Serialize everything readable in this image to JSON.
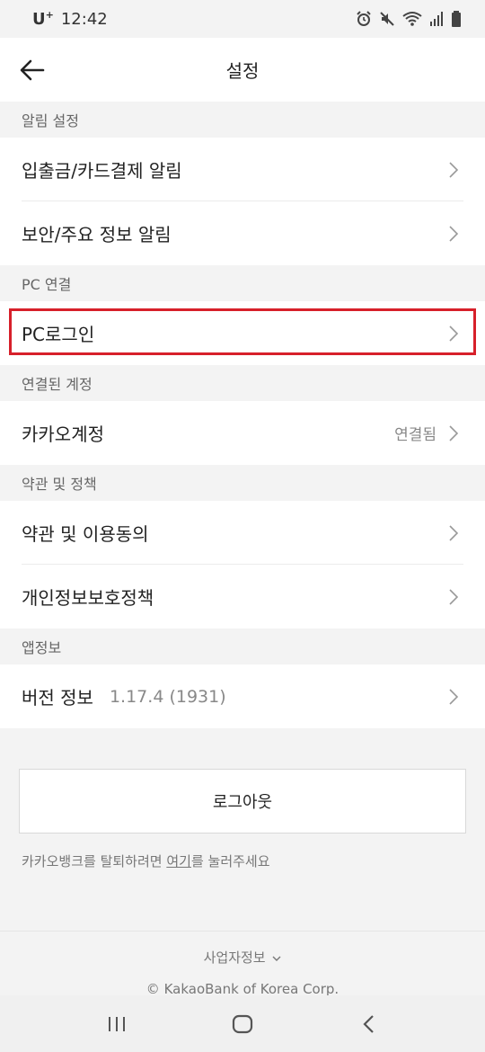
{
  "status_bar": {
    "carrier": "U",
    "carrier_sup": "+",
    "time": "12:42"
  },
  "header": {
    "title": "설정"
  },
  "sections": {
    "notifications": {
      "title": "알림 설정",
      "items": [
        "입출금/카드결제 알림",
        "보안/주요 정보 알림"
      ]
    },
    "pc": {
      "title": "PC 연결",
      "items": [
        "PC로그인"
      ]
    },
    "linked": {
      "title": "연결된 계정",
      "items": [
        {
          "label": "카카오계정",
          "value": "연결됨"
        }
      ]
    },
    "policy": {
      "title": "약관 및 정책",
      "items": [
        "약관 및 이용동의",
        "개인정보보호정책"
      ]
    },
    "appinfo": {
      "title": "앱정보",
      "items": [
        {
          "label": "버전 정보",
          "value": "1.17.4 (1931)"
        }
      ]
    }
  },
  "logout_label": "로그아웃",
  "withdraw": {
    "prefix": "카카오뱅크를 탈퇴하려면 ",
    "link": "여기",
    "suffix": "를 눌러주세요"
  },
  "footer": {
    "biz_info": "사업자정보",
    "copyright": "© KakaoBank of Korea Corp."
  },
  "colors": {
    "highlight": "#d7202a",
    "background": "#f3f3f3"
  }
}
